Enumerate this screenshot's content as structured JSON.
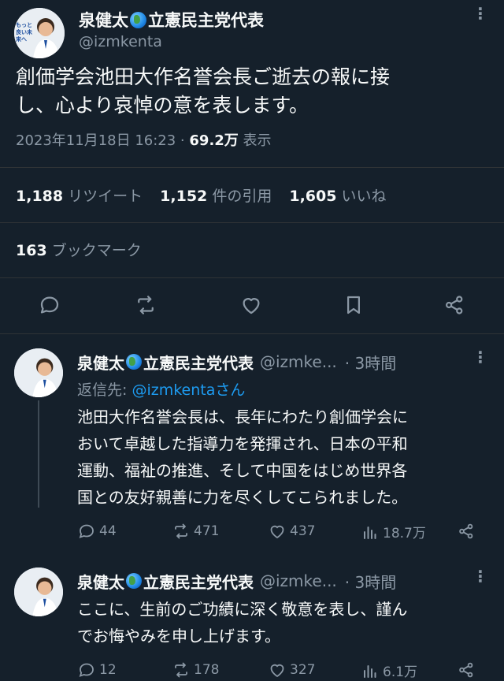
{
  "main_tweet": {
    "display_name": "泉健太",
    "party": "立憲民主党代表",
    "handle": "@izmkenta",
    "avatar_text": "もっと良い未来へ",
    "text_line1": "創価学会池田大作名誉会長ご逝去の報に接",
    "text_line2": "し、心より哀悼の意を表します。",
    "timestamp": "2023年11月18日 16:23 · ",
    "views_count": "69.2万",
    "views_label": " 表示",
    "stats": {
      "retweets_num": "1,188",
      "retweets_label": "リツイート",
      "quotes_num": "1,152",
      "quotes_label": "件の引用",
      "likes_num": "1,605",
      "likes_label": "いいね",
      "bookmarks_num": "163",
      "bookmarks_label": "ブックマーク"
    }
  },
  "replies": [
    {
      "display_name": "泉健太",
      "party": "立憲民主党代表",
      "handle": "@izmke...",
      "time": "· 3時間",
      "reply_to_label": "返信先: ",
      "reply_to_handle": "@izmkentaさん",
      "lines": [
        "池田大作名誉会長は、長年にわたり創価学会に",
        "おいて卓越した指導力を発揮され、日本の平和",
        "運動、福祉の推進、そして中国をはじめ世界各",
        "国との友好親善に力を尽くしてこられました。"
      ],
      "replies": "44",
      "retweets": "471",
      "likes": "437",
      "views": "18.7万"
    },
    {
      "display_name": "泉健太",
      "party": "立憲民主党代表",
      "handle": "@izmke...",
      "time": "· 3時間",
      "lines": [
        "ここに、生前のご功績に深く敬意を表し、謹ん",
        "でお悔やみを申し上げます。"
      ],
      "replies": "12",
      "retweets": "178",
      "likes": "327",
      "views": "6.1万"
    }
  ],
  "colors": {
    "background": "#15202b",
    "accent": "#1d9bf0",
    "muted": "#8b98a5"
  },
  "icons": [
    "reply-icon",
    "retweet-icon",
    "like-icon",
    "bookmark-icon",
    "share-icon",
    "views-icon",
    "more-icon",
    "globe-emoji"
  ]
}
